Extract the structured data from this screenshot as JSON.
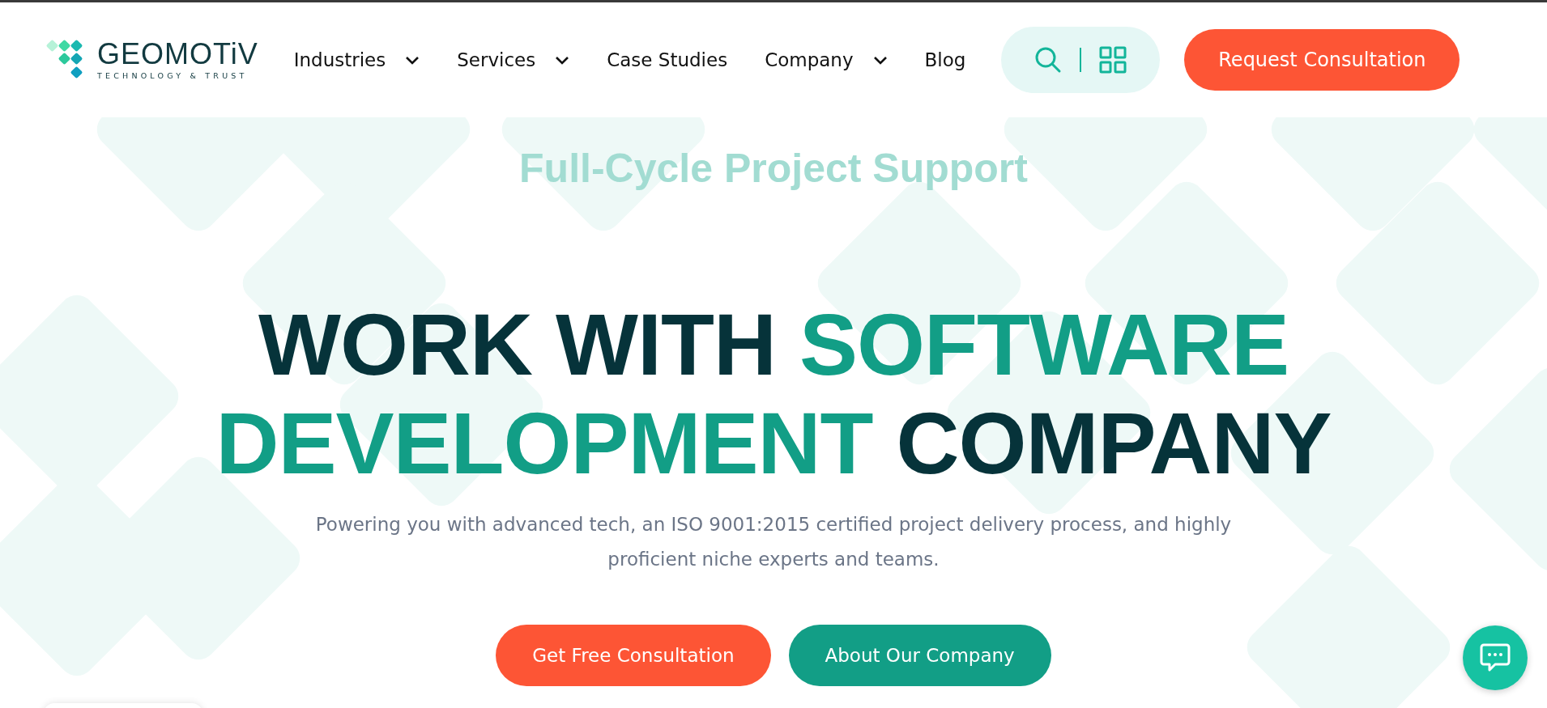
{
  "header": {
    "logo": {
      "name": "GEOMOTiV",
      "tagline": "TECHNOLOGY & TRUST"
    },
    "nav": [
      {
        "label": "Industries",
        "has_dropdown": true
      },
      {
        "label": "Services",
        "has_dropdown": true
      },
      {
        "label": "Case Studies",
        "has_dropdown": false
      },
      {
        "label": "Company",
        "has_dropdown": true
      },
      {
        "label": "Blog",
        "has_dropdown": false
      }
    ],
    "cta": "Request Consultation"
  },
  "hero": {
    "eyebrow": "Full-Cycle Project Support",
    "title_lines": [
      [
        {
          "text": "WORK WITH ",
          "kind": "plain"
        },
        {
          "text": "SOFTWARE",
          "kind": "accent"
        }
      ],
      [
        {
          "text": "DEVELOPMENT",
          "kind": "accent"
        },
        {
          "text": " COMPANY",
          "kind": "plain"
        }
      ]
    ],
    "description": "Powering you with advanced tech, an ISO 9001:2015 certified project delivery process, and highly proficient niche experts and teams.",
    "buttons": [
      {
        "label": "Get Free Consultation",
        "kind": "primary"
      },
      {
        "label": "About Our Company",
        "kind": "secondary"
      }
    ]
  }
}
